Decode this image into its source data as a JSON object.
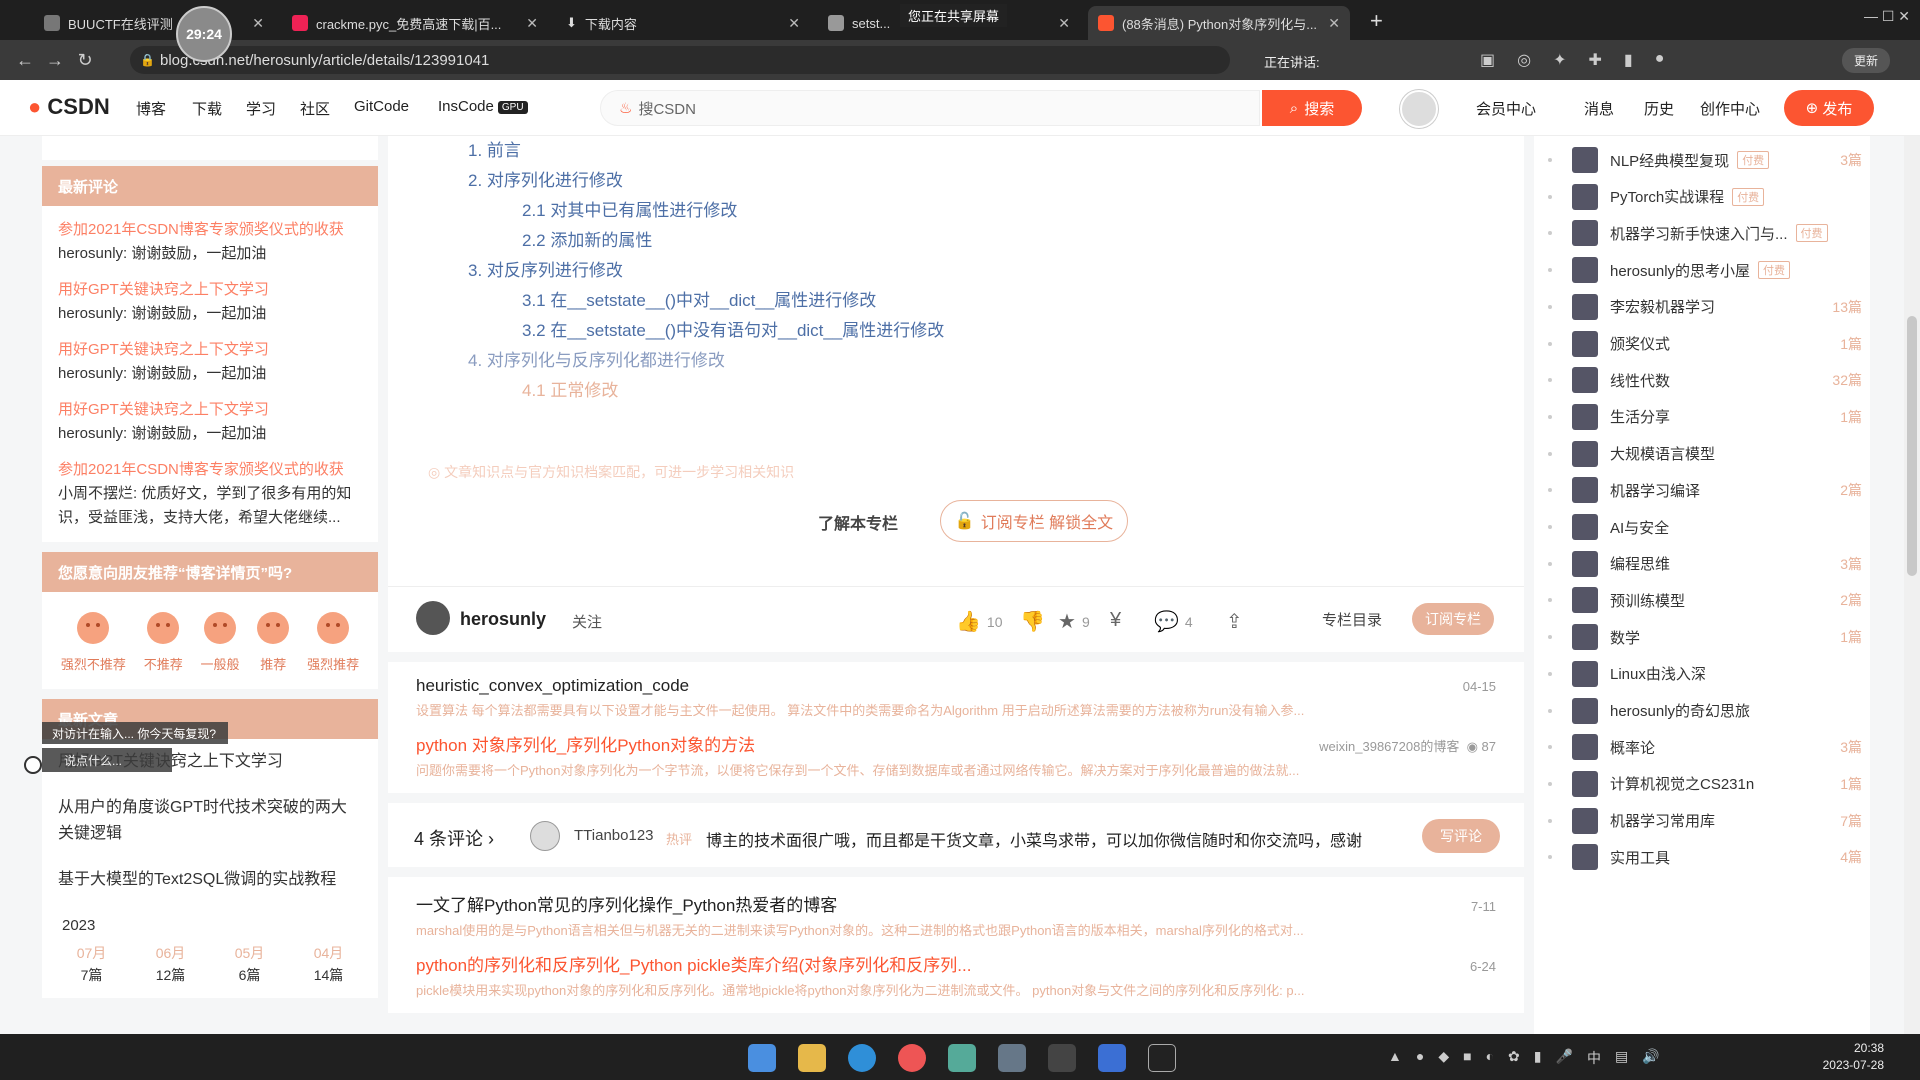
{
  "browser": {
    "timer": "29:24",
    "tabs": [
      {
        "title": "BUUCTF在线评测",
        "active": false
      },
      {
        "title": "crackme.pyc_免费高速下载|百...",
        "active": false
      },
      {
        "title": "下载内容",
        "active": false
      },
      {
        "title": "setst...",
        "active": false
      },
      {
        "title": "(88条消息) Python对象序列化与...",
        "active": true
      }
    ],
    "share_notice": "您正在共享屏幕",
    "url": "blog.csdn.net/herosunly/article/details/123991041",
    "speaking": "正在讲话:",
    "update_label": "更新"
  },
  "csdn_nav": {
    "logo": "CSDN",
    "items": [
      "博客",
      "下载",
      "学习",
      "社区",
      "GitCode",
      "InsCode"
    ],
    "gpu_badge": "GPU",
    "search_placeholder": "搜CSDN",
    "search_button": "搜索",
    "right_items": [
      "会员中心",
      "消息",
      "历史",
      "创作中心"
    ],
    "publish": "发布"
  },
  "left_sidebar": {
    "latest_comments_title": "最新评论",
    "comments": [
      {
        "title": "参加2021年CSDN博客专家颁奖仪式的收获",
        "body": "herosunly: 谢谢鼓励，一起加油"
      },
      {
        "title": "用好GPT关键诀窍之上下文学习",
        "body": "herosunly: 谢谢鼓励，一起加油"
      },
      {
        "title": "用好GPT关键诀窍之上下文学习",
        "body": "herosunly: 谢谢鼓励，一起加油"
      },
      {
        "title": "用好GPT关键诀窍之上下文学习",
        "body": "herosunly: 谢谢鼓励，一起加油"
      },
      {
        "title": "参加2021年CSDN博客专家颁奖仪式的收获",
        "body": "小周不摆烂: 优质好文，学到了很多有用的知识，受益匪浅，支持大佬，希望大佬继续..."
      }
    ],
    "recommend_title": "您愿意向朋友推荐“博客详情页”吗?",
    "recommend_options": [
      "强烈不推荐",
      "不推荐",
      "一般般",
      "推荐",
      "强烈推荐"
    ],
    "latest_articles_title": "最新文章",
    "articles": [
      "用好GPT关键诀窍之上下文学习",
      "从用户的角度谈GPT时代技术突破的两大关键逻辑",
      "基于大模型的Text2SQL微调的实战教程"
    ],
    "archive_year": "2023",
    "archive": [
      {
        "month": "07月",
        "count": "7篇"
      },
      {
        "month": "06月",
        "count": "12篇"
      },
      {
        "month": "05月",
        "count": "6篇"
      },
      {
        "month": "04月",
        "count": "14篇"
      }
    ],
    "floating_hint": "对访计在输入...    你今天每复现?",
    "floating_hint2": "说点什么..."
  },
  "toc": {
    "items": [
      {
        "level": 1,
        "text": "1. 前言",
        "faded": false
      },
      {
        "level": 1,
        "text": "2. 对序列化进行修改",
        "faded": false
      },
      {
        "level": 2,
        "text": "2.1 对其中已有属性进行修改",
        "faded": false
      },
      {
        "level": 2,
        "text": "2.2 添加新的属性",
        "faded": false
      },
      {
        "level": 1,
        "text": "3. 对反序列进行修改",
        "faded": false
      },
      {
        "level": 2,
        "text": "3.1 在__setstate__()中对__dict__属性进行修改",
        "faded": false
      },
      {
        "level": 2,
        "text": "3.2 在__setstate__()中没有语句对__dict__属性进行修改",
        "faded": false
      },
      {
        "level": 1,
        "text": "4. 对序列化与反序列化都进行修改",
        "faded": true
      },
      {
        "level": 2,
        "text": "4.1 正常修改",
        "faded": true
      }
    ],
    "kb_note": "文章知识点与官方知识档案匹配，可进一步学习相关知识",
    "learn_column": "了解本专栏",
    "subscribe_unlock": "订阅专栏 解锁全文"
  },
  "author_bar": {
    "name": "herosunly",
    "follow": "关注",
    "likes": "10",
    "stars": "9",
    "comments": "4",
    "column_dir": "专栏目录",
    "subscribe_col": "订阅专栏"
  },
  "related": [
    {
      "title": "heuristic_convex_optimization_code",
      "date": "04-15",
      "desc": "设置算法 每个算法都需要具有以下设置才能与主文件一起使用。 算法文件中的类需要命名为Algorithm 用于启动所述算法需要的方法被称为run没有输入参...",
      "orange": false
    },
    {
      "title": "python 对象序列化_序列化Python对象的方法",
      "date": "weixin_39867208的博客",
      "views": "87",
      "desc": "问题你需要将一个Python对象序列化为一个字节流，以便将它保存到一个文件、存储到数据库或者通过网络传输它。解决方案对于序列化最普遍的做法就...",
      "orange": true
    }
  ],
  "comment_strip": {
    "count": "4 条评论",
    "user": "TTianbo123",
    "hot": "热评",
    "text": "博主的技术面很广哦，而且都是干货文章，小菜鸟求带，可以加你微信随时和你交流吗，感谢",
    "write": "写评论"
  },
  "related2": [
    {
      "title": "一文了解Python常见的序列化操作_Python热爱者的博客",
      "date": "7-11",
      "desc": "marshal使用的是与Python语言相关但与机器无关的二进制来读写Python对象的。这种二进制的格式也跟Python语言的版本相关，marshal序列化的格式对..."
    },
    {
      "title": "python的序列化和反序列化_Python pickle类库介绍(对象序列化和反序列...",
      "date": "6-24",
      "desc": "pickle模块用来实现python对象的序列化和反序列化。通常地pickle将python对象序列化为二进制流或文件。 python对象与文件之间的序列化和反序列化: p..."
    }
  ],
  "right_sidebar": {
    "columns": [
      {
        "name": "NLP经典模型复现",
        "paid": true,
        "count": "3篇"
      },
      {
        "name": "PyTorch实战课程",
        "paid": true,
        "count": ""
      },
      {
        "name": "机器学习新手快速入门与...",
        "paid": true,
        "count": ""
      },
      {
        "name": "herosunly的思考小屋",
        "paid": true,
        "count": ""
      },
      {
        "name": "李宏毅机器学习",
        "paid": false,
        "count": "13篇"
      },
      {
        "name": "颁奖仪式",
        "paid": false,
        "count": "1篇"
      },
      {
        "name": "线性代数",
        "paid": false,
        "count": "32篇"
      },
      {
        "name": "生活分享",
        "paid": false,
        "count": "1篇"
      },
      {
        "name": "大规模语言模型",
        "paid": false,
        "count": ""
      },
      {
        "name": "机器学习编译",
        "paid": false,
        "count": "2篇"
      },
      {
        "name": "AI与安全",
        "paid": false,
        "count": ""
      },
      {
        "name": "编程思维",
        "paid": false,
        "count": "3篇"
      },
      {
        "name": "预训练模型",
        "paid": false,
        "count": "2篇"
      },
      {
        "name": "数学",
        "paid": false,
        "count": "1篇"
      },
      {
        "name": "Linux由浅入深",
        "paid": false,
        "count": ""
      },
      {
        "name": "herosunly的奇幻思旅",
        "paid": false,
        "count": ""
      },
      {
        "name": "概率论",
        "paid": false,
        "count": "3篇"
      },
      {
        "name": "计算机视觉之CS231n",
        "paid": false,
        "count": "1篇"
      },
      {
        "name": "机器学习常用库",
        "paid": false,
        "count": "7篇"
      },
      {
        "name": "实用工具",
        "paid": false,
        "count": "4篇"
      }
    ],
    "paid_label": "付费"
  },
  "taskbar": {
    "tray_lang": "中",
    "time": "20:38",
    "date": "2023-07-28"
  },
  "colors": {
    "brand": "#fc5531",
    "accent_faded": "#e8b39b",
    "link": "#4d6fa6"
  }
}
